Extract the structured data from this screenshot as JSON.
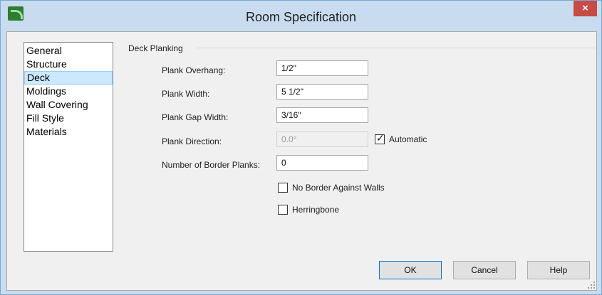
{
  "window": {
    "title": "Room Specification",
    "close_glyph": "×"
  },
  "nav": {
    "items": [
      {
        "label": "General",
        "active": false
      },
      {
        "label": "Structure",
        "active": false
      },
      {
        "label": "Deck",
        "active": true
      },
      {
        "label": "Moldings",
        "active": false
      },
      {
        "label": "Wall Covering",
        "active": false
      },
      {
        "label": "Fill Style",
        "active": false
      },
      {
        "label": "Materials",
        "active": false
      }
    ]
  },
  "deck": {
    "group_title": "Deck Planking",
    "plank_overhang": {
      "label": "Plank Overhang:",
      "value": "1/2\""
    },
    "plank_width": {
      "label": "Plank Width:",
      "value": "5 1/2\""
    },
    "plank_gap_width": {
      "label": "Plank Gap Width:",
      "value": "3/16\""
    },
    "plank_direction": {
      "label": "Plank Direction:",
      "value": "0.0°",
      "disabled": true
    },
    "automatic": {
      "label": "Automatic",
      "checked": true
    },
    "border_planks": {
      "label": "Number of Border Planks:",
      "value": "0"
    },
    "no_border_against_walls": {
      "label": "No Border Against Walls",
      "checked": false
    },
    "herringbone": {
      "label": "Herringbone",
      "checked": false
    }
  },
  "buttons": {
    "ok": "OK",
    "cancel": "Cancel",
    "help": "Help"
  },
  "colors": {
    "titlebar": "#c9dcef",
    "close": "#c74c45",
    "selection": "#cce8ff",
    "primary_border": "#0078d7"
  }
}
